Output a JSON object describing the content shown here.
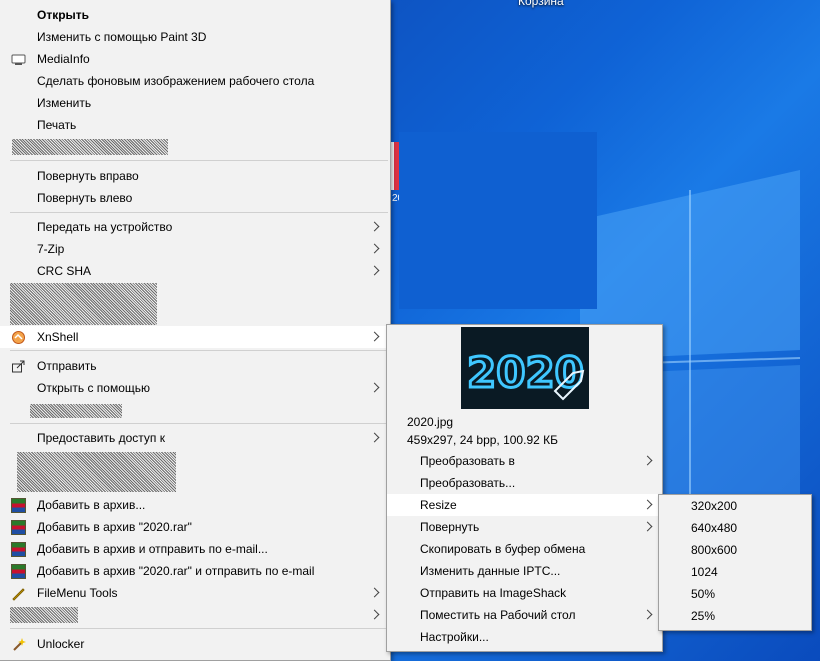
{
  "desktop": {
    "top_label": "Корзина"
  },
  "main_menu": {
    "open": "Открыть",
    "edit_paint3d": "Изменить с помощью Paint 3D",
    "mediainfo": "MediaInfo",
    "set_wallpaper": "Сделать фоновым изображением рабочего стола",
    "edit": "Изменить",
    "print": "Печать",
    "rotate_right": "Повернуть вправо",
    "rotate_left": "Повернуть влево",
    "cast": "Передать на устройство",
    "sevenzip": "7-Zip",
    "crcsha": "CRC SHA",
    "xnshell": "XnShell",
    "share": "Отправить",
    "open_with": "Открыть с помощью",
    "give_access": "Предоставить доступ к",
    "rar_add": "Добавить в архив...",
    "rar_add_named": "Добавить в архив \"2020.rar\"",
    "rar_add_email": "Добавить в архив и отправить по e-mail...",
    "rar_add_named_email": "Добавить в архив \"2020.rar\" и отправить по e-mail",
    "filemenu": "FileMenu Tools",
    "unlocker": "Unlocker"
  },
  "xnshell_menu": {
    "preview_text": "2020",
    "filename": "2020.jpg",
    "fileinfo": "459x297, 24 bpp, 100.92 КБ",
    "convert_to": "Преобразовать в",
    "convert": "Преобразовать...",
    "resize": "Resize",
    "rotate": "Повернуть",
    "copy_clipboard": "Скопировать в буфер обмена",
    "edit_iptc": "Изменить данные IPTC...",
    "send_imageshack": "Отправить на ImageShack",
    "place_desktop": "Поместить на Рабочий стол",
    "settings": "Настройки..."
  },
  "resize_menu": {
    "items": [
      "320x200",
      "640x480",
      "800x600",
      "1024",
      "50%",
      "25%"
    ]
  }
}
